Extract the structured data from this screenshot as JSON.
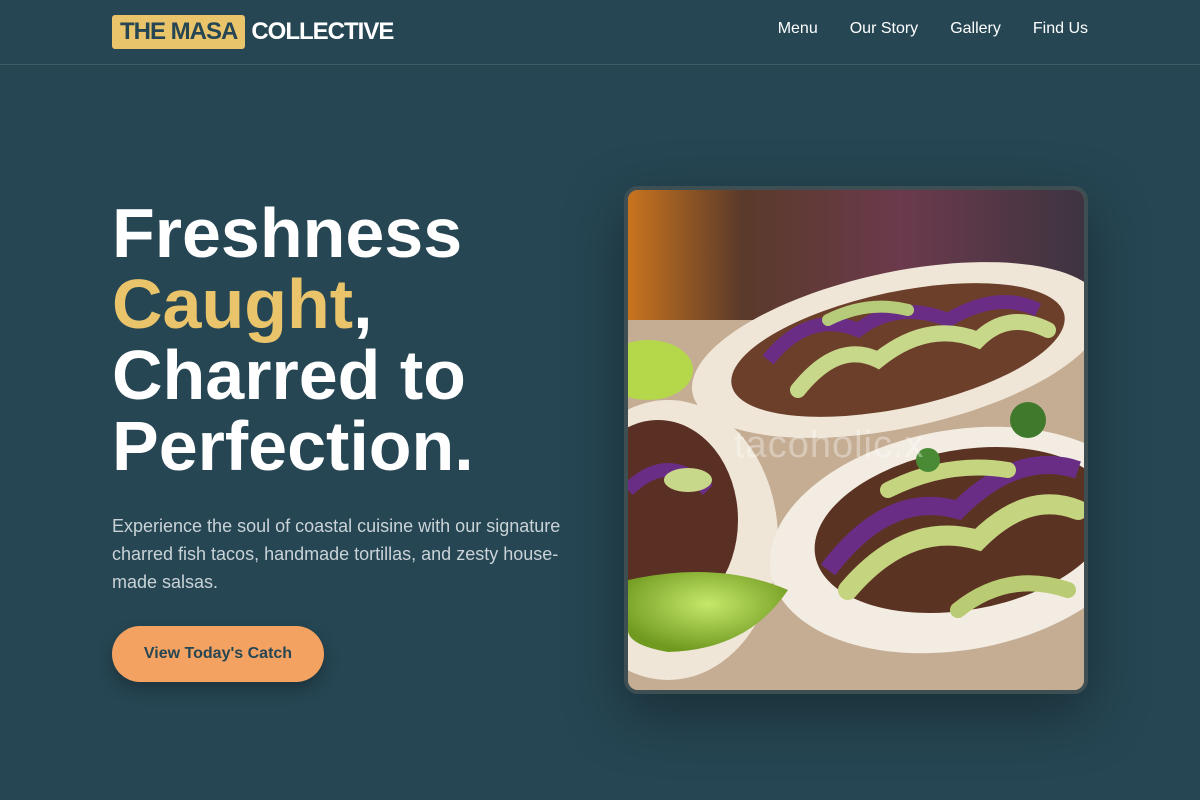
{
  "brand": {
    "badge": "THE MASA",
    "rest": "COLLECTIVE"
  },
  "nav": {
    "items": [
      {
        "label": "Menu"
      },
      {
        "label": "Our Story"
      },
      {
        "label": "Gallery"
      },
      {
        "label": "Find Us"
      }
    ]
  },
  "hero": {
    "title_line1": "Freshness",
    "title_accent": "Caught",
    "title_comma": ",",
    "title_line3": "Charred to",
    "title_line4": "Perfection.",
    "description": "Experience the soul of coastal cuisine with our signature charred fish tacos, handmade tortillas, and zesty house-made salsas.",
    "cta_label": "View Today's Catch",
    "image_watermark": "tacoholic.x"
  },
  "colors": {
    "background": "#264653",
    "accent_yellow": "#e9c46a",
    "accent_orange": "#f4a261",
    "text_light": "#c9d3d7"
  }
}
